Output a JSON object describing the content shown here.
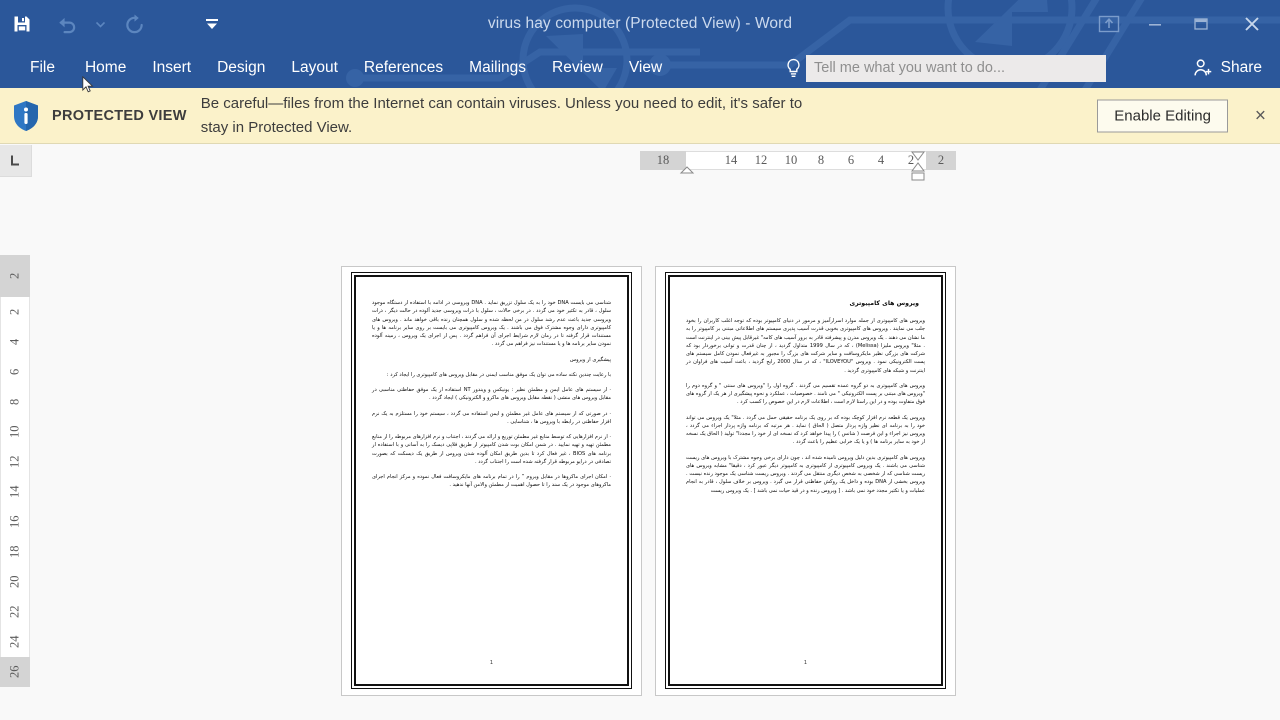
{
  "window": {
    "title": "virus hay computer (Protected View) - Word",
    "quick_access": [
      {
        "name": "save-icon",
        "label": "Save",
        "enabled": true
      },
      {
        "name": "undo-icon",
        "label": "Undo",
        "enabled": false
      },
      {
        "name": "undo-dropdown-icon",
        "label": "Undo options",
        "enabled": false
      },
      {
        "name": "redo-icon",
        "label": "Redo",
        "enabled": false
      },
      {
        "name": "customize-qat-icon",
        "label": "Customize Quick Access Toolbar",
        "enabled": true
      }
    ],
    "controls": [
      {
        "name": "ribbon-display-options-icon",
        "label": "Ribbon Display Options"
      },
      {
        "name": "minimize-icon",
        "label": "Minimize"
      },
      {
        "name": "restore-icon",
        "label": "Restore Down"
      },
      {
        "name": "close-icon",
        "label": "Close"
      }
    ],
    "colors": {
      "titlebar": "#2b579a",
      "banner": "#fbf2ca",
      "canvas": "#f9f9f9",
      "accent": "#2b579a"
    }
  },
  "ribbon": {
    "tabs": [
      {
        "label": "File",
        "active": false
      },
      {
        "label": "Home",
        "active": false
      },
      {
        "label": "Insert",
        "active": false
      },
      {
        "label": "Design",
        "active": false
      },
      {
        "label": "Layout",
        "active": false
      },
      {
        "label": "References",
        "active": false
      },
      {
        "label": "Mailings",
        "active": false
      },
      {
        "label": "Review",
        "active": false
      },
      {
        "label": "View",
        "active": false
      }
    ],
    "tellme": {
      "icon": "lightbulb-icon",
      "placeholder": "Tell me what you want to do...",
      "value": ""
    },
    "share": {
      "icon": "share-person-icon",
      "label": "Share"
    }
  },
  "protected_view": {
    "icon": "info-shield-icon",
    "title": "PROTECTED VIEW",
    "message": "Be careful—files from the Internet can contain viruses. Unless you need to edit, it's safer to stay in Protected View.",
    "enable_button": "Enable Editing",
    "close_icon": "close-icon",
    "close_label": "×"
  },
  "rulers": {
    "tab_selector": {
      "icon": "left-tab-stop-icon",
      "label": "L"
    },
    "horizontal": {
      "gray_left": "18",
      "ticks": [
        "14",
        "12",
        "10",
        "8",
        "6",
        "4",
        "2"
      ],
      "gray_right": "2"
    },
    "vertical": {
      "gray_top": "2",
      "ticks": [
        "2",
        "4",
        "6",
        "8",
        "10",
        "12",
        "14",
        "16",
        "18",
        "20",
        "22",
        "24"
      ],
      "gray_bottom": "26"
    }
  },
  "document": {
    "pages": [
      {
        "number": "1",
        "heading": "",
        "paragraphs": [
          "شناسی می بایست DNA خود را به یک سلول تزریق نماید . DNA ویروسی در ادامه با استفاده از دستگاه موجود سلول ، قادر به تکثیر خود می گردد . در برخی حالات ، سلول با ذرات ویروسی جدید آلوده در حالت دیگر ، ذرات ویروسی جدید باعث عدم رشد سلول در من لحظه شده و سلول همچنان زنده باقی خواهد ماند . ویروس های کامپیوتری دارای وجوه مشترک فوق می باشند . یک ویروس کامپیوتری می بایست بر روی سایر برنامه ها و یا مستندات قرار گرفته تا در زمان لازم شرایط اجرای آن فراهم گردد . پس از اجرای یک ویروس ، زمینه آلوده نمودن سایر برنامه ها و یا مستندات نیز فراهم می گردد .",
          "پیشگیری از ویروس",
          "با رعایت چندین نکته ساده می توان یک موفق مناسب ایمنی در مقابل ویروس های کامپیوتری را ایجاد کرد :",
          "· از سیستم های عامل ایمن و مطمئن نظیر : یونیکس و ویندوز NT استفاده از یک موفق حفاظتی مناسبی در مقابل ویروس های منشی ( نقطه مقابل ویروس های ماکرو و الکترونیکی ) ایجاد گردد .",
          "· در صورتی که از سیستم های عامل غیر مطمئن و ایمن استفاده می گردد ، سیستم خود را مستلزم به یک نرم افزار حفاظتی در رابطه با ویروس ها ، شناسایی .",
          "· از نرم افزارهایی که توسط منابع غیر مطمئن توزیع و ارائه می گردند ، اجتناب و نرم افزارهای مربوطه را از منابع مطمئن تهیه و تهیه نمایید . در شمن امکان بوت شدن کامپیوتر از طریق فلاپی دیسک را به آسانی و با استفاده از برنامه های BIOS ، غیر فعال کرد تا بدین طریق امکان آلوده شدن ویروس از طریق یک دیسکت که بصورت تصادفی در درایو مربوطه قرار گرفته شده است را اجتناب گردد .",
          "· امکان اجرای ماکروها در مقابل ویروم ” را در تمام برنامه های مایکروسافت فعال نموده و مرکز انجام اجرای ماکروهای موجود در یک سند را تا حصول اهمیت از مطمئن والامن آنها ندهید ."
        ]
      },
      {
        "number": "1",
        "heading": "ویروس های کامپیوتری",
        "paragraphs": [
          "ویروس های کامپیوتری  از جمله موارد اسرارآمیز و مرموز در دنیای کامپیوتر بوده که توجه اغلب کاربران را بخود جلب می نمایند . ویروس های کامپیوتری بخوبی قدرت آسیب پذیری سیستم های اطلاعاتی مبتنی بر کامپیوتر را به ما نشان می دهند . یک ویروس مدرن و پیشرفته قادر به بروز آسیب های کامه\" غیرقابل پیش بینی در اینترنت است . مثلا\" ویروس ملیزا (Melissa) ، که در سال 1999 متداول گردید ، از چنان قدرت و توانی برخوردار بود که شرکت های بزرگی نظیر مایکروسافت و سایر شرکت های بزرگ را مجبور به غیرفعال نمودن کامل سیستم های پست الکترونیکی نمود . ویروس \"ILOVEYOU\" ، که در سال 2000 رایج گردید ، باعث آسیب های فراوان در اینترنت و شبکه های کامپیوتری گردید .",
          "ویروس های کامپیوتری به دو گروه عمده تقسیم می گردند . گروه اول را \"ویروس های سنتی \" و گروه دوم را \"ویروس های مبتنی بر پست الکترونیکی \" می نامند . خصوصیات ، عملکرد و نحوه پیشگیری از هر یک از گروه های فوق متفاوت بوده و در این راستا لازم است ، اطلاعات لازم در این خصوص را کسب کرد .",
          "ویروس یک قطعه نرم افزار کوچک  بوده که بر روی یک برنامه حقیقی حمل می گردد . مثلا\" یک ویروس می تواند خود را به برنامه ای نظیر واژه پرداز متصل ( الحاق ) نماید . هر مرتبه که برنامه واژه پرداز اجراء می گردد ، ویروس نیز اجراء و این فرصت ( شانس ) را پیدا خواهد کرد که نسخه ای از خود را مجددا\" تولید ( الحاق یک نسخه از خود به سایر برنامه ها ) و یا یک خرابی عظیم را باعث گردد .",
          "ویروس های کامپیوتری بدین دلیل ویروس نامیده شده اند ، چون دارای برخی وجوه مشترک با ویروس های زیست شناسی می باشند . یک ویروس کامپیوتری از کامپیوتری به کامپیوتر دیگر عبور کرد ، دقیقا\" مشابه ویروس های زیست شناسی که از شخصی به شخص دیگری منتقل می گردند . ویروس زیست شناسی یک موجود زنده نیست . ویروس بخشی از DNA بوده و داخل یک روکش حفاظتی قرار می گیرد . ویروس بر خلاف سلول ، قادر به انجام عملیات و یا تکثیر مجدد خود نمی باشد . [ ویروس زنده و در قید حیات نمی باشد ] . یک ویروس زیست"
        ]
      }
    ]
  }
}
